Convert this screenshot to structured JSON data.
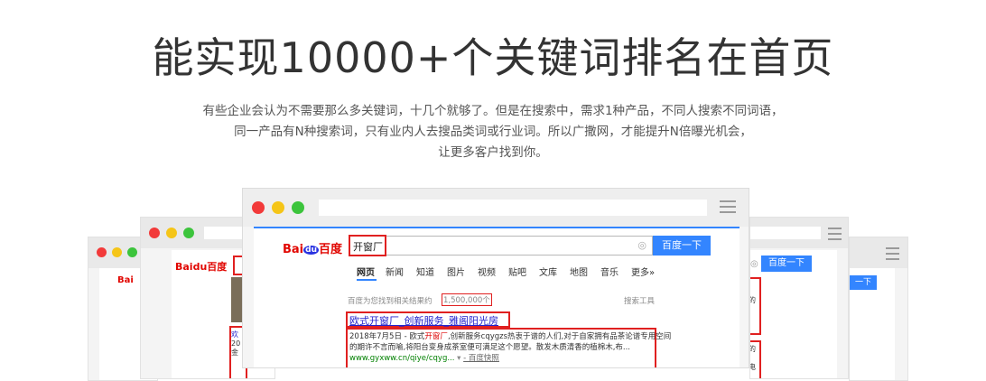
{
  "headline": "能实现10000+个关键词排名在首页",
  "intro": {
    "line1": "有些企业会认为不需要那么多关键词，十几个就够了。但是在搜索中，需求1种产品，不同人搜索不同词语，",
    "line2": "同一产品有N种搜索词，只有业内人去搜品类词或行业词。所以广撒网，才能提升N倍曝光机会，",
    "line3": "让更多客户找到你。"
  },
  "browser": {
    "logo_bai": "Bai",
    "logo_du": "du",
    "logo_cn": "百度",
    "query": "开窗厂",
    "search_button": "百度一下",
    "tabs": [
      "网页",
      "新闻",
      "知道",
      "图片",
      "视频",
      "贴吧",
      "文库",
      "地图",
      "音乐",
      "更多»"
    ],
    "result_count_prefix": "百度为您找到相关结果约",
    "result_count": "1,500,000个",
    "search_tools": "搜索工具",
    "result": {
      "title": "欧式开窗厂_创新服务_雅阁阳光房",
      "desc_line1_a": "2018年7月5日 - 欧式",
      "desc_line1_kw": "开窗厂",
      "desc_line1_b": ",创新服务cqygzs热衷于谱的人们,对于自家拥有品茶论谱专用空间",
      "desc_line2": "的期许不言而喻,将阳台变身成茶室便可满足这个愿望。散发木质清香的植棉木,布...",
      "url": "www.gyxww.cn/qiye/cqyg...",
      "snapshot": "- 百度快照"
    }
  },
  "side_windows": {
    "left_logo": "Baidu百度",
    "left_small_logo": "Bai",
    "right_button": "百度一下",
    "right_small_button": "一下",
    "left_snip1": "欢",
    "left_snip2": "20",
    "left_snip3": "金",
    "right_snip1": "的",
    "right_snip2": "的",
    "right_snip3": "电"
  },
  "colors": {
    "dot_red": "#f23a3a",
    "dot_yellow": "#f5c518",
    "dot_green": "#3cc43c",
    "accent_blue": "#3385ff",
    "highlight_red": "#e02020"
  }
}
